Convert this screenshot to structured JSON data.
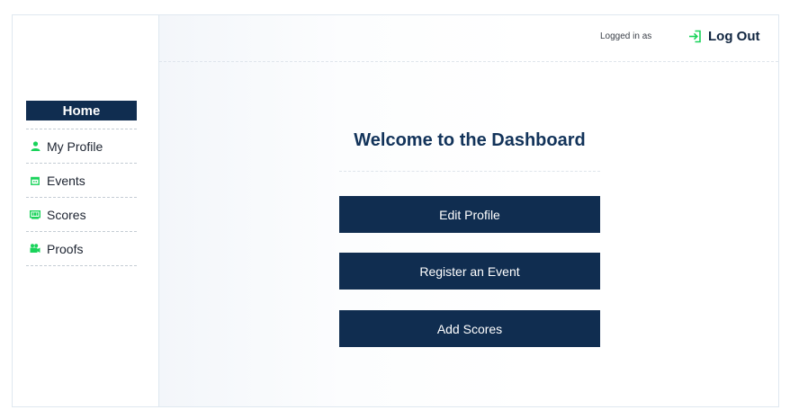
{
  "header": {
    "logged_in_label": "Logged in as",
    "logout_label": "Log Out",
    "logout_icon": "login-arrow-icon"
  },
  "sidebar": {
    "home_label": "Home",
    "items": [
      {
        "label": "My Profile",
        "icon": "user-icon"
      },
      {
        "label": "Events",
        "icon": "calendar-icon"
      },
      {
        "label": "Scores",
        "icon": "scoreboard-icon"
      },
      {
        "label": "Proofs",
        "icon": "video-camera-icon"
      }
    ]
  },
  "main": {
    "title": "Welcome to the Dashboard",
    "buttons": [
      {
        "label": "Edit Profile"
      },
      {
        "label": "Register an Event"
      },
      {
        "label": "Add Scores"
      }
    ]
  },
  "colors": {
    "navy": "#102d50",
    "accent_green": "#19d35a",
    "border": "#dfe8f0"
  }
}
